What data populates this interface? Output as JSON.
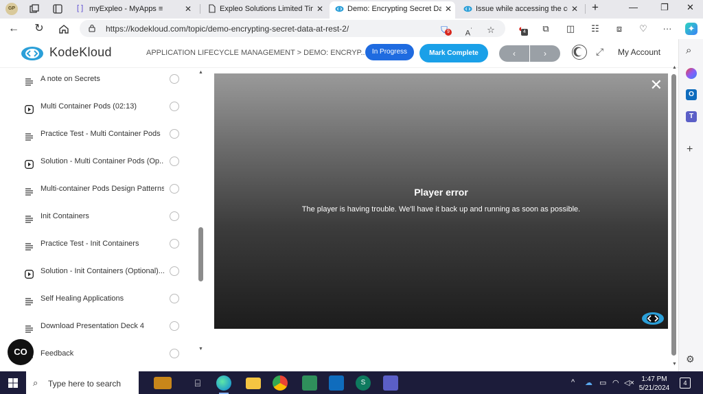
{
  "browser": {
    "profile_initials": "GP",
    "tabs": [
      {
        "label": "myExpleo - MyApps ≡",
        "active": false
      },
      {
        "label": "Expleo Solutions Limited Timesl",
        "active": false
      },
      {
        "label": "Demo: Encrypting Secret Data a",
        "active": true
      },
      {
        "label": "Issue while accessing the cours",
        "active": false
      }
    ],
    "new_tab": "+",
    "url": "https://kodekloud.com/topic/demo-encrypting-secret-data-at-rest-2/",
    "badges": {
      "shield": "9",
      "ext": "4"
    }
  },
  "site": {
    "brand": "KodeKloud",
    "breadcrumb": "APPLICATION LIFECYCLE MANAGEMENT > DEMO: ENCRYP...",
    "status_button": "In Progress",
    "complete_button": "Mark Complete",
    "prev": "‹",
    "next": "›",
    "account": "My Account",
    "colors": {
      "primary": "#1f6be0",
      "accent": "#1aa0e8",
      "nav_gray": "#9aa0a6"
    }
  },
  "sidebar": {
    "lessons": [
      {
        "icon": "list-icon",
        "label": "A note on Secrets"
      },
      {
        "icon": "play-icon",
        "label": "Multi Container Pods (02:13)"
      },
      {
        "icon": "list-icon",
        "label": "Practice Test - Multi Container Pods"
      },
      {
        "icon": "play-icon",
        "label": "Solution - Multi Container Pods (Op..."
      },
      {
        "icon": "list-icon",
        "label": "Multi-container Pods Design Patterns"
      },
      {
        "icon": "list-icon",
        "label": "Init Containers"
      },
      {
        "icon": "list-icon",
        "label": "Practice Test - Init Containers"
      },
      {
        "icon": "play-icon",
        "label": "Solution - Init Containers (Optional)..."
      },
      {
        "icon": "list-icon",
        "label": "Self Healing Applications"
      },
      {
        "icon": "list-icon",
        "label": "Download Presentation Deck 4"
      },
      {
        "icon": "list-icon",
        "label": "Feedback"
      }
    ],
    "chat_label": "CO"
  },
  "player": {
    "error_title": "Player error",
    "error_message": "The player is having trouble. We'll have it back up and running as soon as possible."
  },
  "taskbar": {
    "search_placeholder": "Type here to search",
    "time": "1:47 PM",
    "date": "5/21/2024",
    "notifications": "4"
  }
}
